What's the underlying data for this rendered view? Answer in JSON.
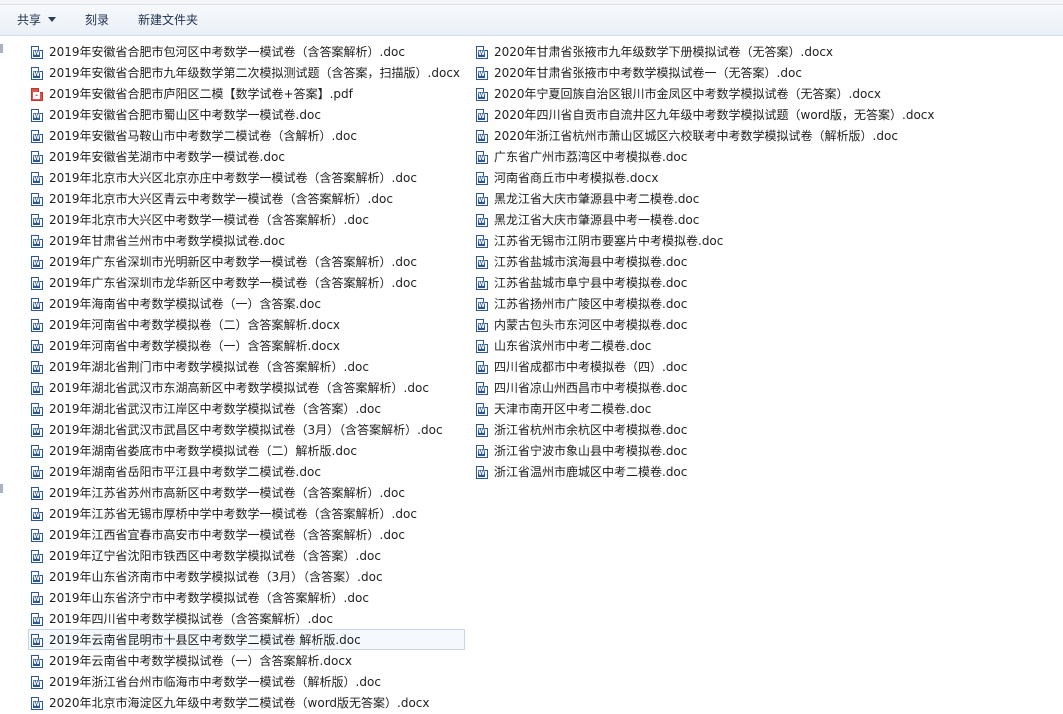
{
  "toolbar": {
    "share_label": "共享",
    "burn_label": "刻录",
    "new_folder_label": "新建文件夹"
  },
  "colors": {
    "word_icon": "#2b5797",
    "pdf_icon": "#d9534f",
    "selection_border": "#c7d5e8"
  },
  "files_col1": [
    {
      "name": "2019年安徽省合肥市包河区中考数学一模试卷（含答案解析）.doc",
      "icon": "word-icon"
    },
    {
      "name": "2019年安徽省合肥市九年级数学第二次模拟测试题（含答案，扫描版）.docx",
      "icon": "word-icon"
    },
    {
      "name": "2019年安徽省合肥市庐阳区二模【数学试卷+答案】.pdf",
      "icon": "pdf-icon"
    },
    {
      "name": "2019年安徽省合肥市蜀山区中考数学一模试卷.doc",
      "icon": "word-icon"
    },
    {
      "name": "2019年安徽省马鞍山市中考数学二模试卷（含解析）.doc",
      "icon": "word-icon"
    },
    {
      "name": "2019年安徽省芜湖市中考数学一模试卷.doc",
      "icon": "word-icon"
    },
    {
      "name": "2019年北京市大兴区北京亦庄中考数学一模试卷（含答案解析）.doc",
      "icon": "word-icon"
    },
    {
      "name": "2019年北京市大兴区青云中考数学一模试卷（含答案解析）.doc",
      "icon": "word-icon"
    },
    {
      "name": "2019年北京市大兴区中考数学一模试卷（含答案解析）.doc",
      "icon": "word-icon"
    },
    {
      "name": "2019年甘肃省兰州市中考数学模拟试卷.doc",
      "icon": "word-icon"
    },
    {
      "name": "2019年广东省深圳市光明新区中考数学一模试卷（含答案解析）.doc",
      "icon": "word-icon"
    },
    {
      "name": "2019年广东省深圳市龙华新区中考数学一模试卷（含答案解析）.doc",
      "icon": "word-icon"
    },
    {
      "name": "2019年海南省中考数学模拟试卷（一）含答案.doc",
      "icon": "word-icon"
    },
    {
      "name": "2019年河南省中考数学模拟卷（二）含答案解析.docx",
      "icon": "word-icon"
    },
    {
      "name": "2019年河南省中考数学模拟卷（一）含答案解析.docx",
      "icon": "word-icon"
    },
    {
      "name": "2019年湖北省荆门市中考数学模拟试卷（含答案解析）.doc",
      "icon": "word-icon"
    },
    {
      "name": "2019年湖北省武汉市东湖高新区中考数学模拟试卷（含答案解析）.doc",
      "icon": "word-icon"
    },
    {
      "name": "2019年湖北省武汉市江岸区中考数学模拟试卷（含答案）.doc",
      "icon": "word-icon"
    },
    {
      "name": "2019年湖北省武汉市武昌区中考数学模拟试卷（3月）（含答案解析）.doc",
      "icon": "word-icon"
    },
    {
      "name": "2019年湖南省娄底市中考数学模拟试卷（二）解析版.doc",
      "icon": "word-icon"
    },
    {
      "name": "2019年湖南省岳阳市平江县中考数学二模试卷.doc",
      "icon": "word-icon"
    },
    {
      "name": "2019年江苏省苏州市高新区中考数学一模试卷（含答案解析）.doc",
      "icon": "word-icon"
    },
    {
      "name": "2019年江苏省无锡市厚桥中学中考数学一模试卷（含答案解析）.doc",
      "icon": "word-icon"
    },
    {
      "name": "2019年江西省宜春市高安市中考数学一模试卷（含答案解析）.doc",
      "icon": "word-icon"
    },
    {
      "name": "2019年辽宁省沈阳市铁西区中考数学模拟试卷（含答案）.doc",
      "icon": "word-icon"
    },
    {
      "name": "2019年山东省济南市中考数学模拟试卷（3月）（含答案）.doc",
      "icon": "word-icon"
    },
    {
      "name": "2019年山东省济宁市中考数学模拟试卷（含答案解析）.doc",
      "icon": "word-icon"
    },
    {
      "name": "2019年四川省中考数学模拟试卷（含答案解析）.doc",
      "icon": "word-icon"
    },
    {
      "name": "2019年云南省昆明市十县区中考数学二模试卷  解析版.doc",
      "icon": "word-icon",
      "selected": true
    },
    {
      "name": "2019年云南省中考数学模拟试卷（一）含答案解析.docx",
      "icon": "word-icon"
    },
    {
      "name": "2019年浙江省台州市临海市中考数学一模试卷（解析版）.doc",
      "icon": "word-icon"
    },
    {
      "name": "2020年北京市海淀区九年级中考数学二模试卷（word版无答案）.docx",
      "icon": "word-icon"
    }
  ],
  "files_col2": [
    {
      "name": "2020年甘肃省张掖市九年级数学下册模拟试卷（无答案）.docx",
      "icon": "word-icon"
    },
    {
      "name": "2020年甘肃省张掖市中考数学模拟试卷一（无答案）.doc",
      "icon": "word-icon"
    },
    {
      "name": "2020年宁夏回族自治区银川市金凤区中考数学模拟试卷（无答案）.docx",
      "icon": "word-icon"
    },
    {
      "name": "2020年四川省自贡市自流井区九年级中考数学模拟试题（word版，无答案）.docx",
      "icon": "word-icon"
    },
    {
      "name": "2020年浙江省杭州市萧山区城区六校联考中考数学模拟试卷（解析版）.doc",
      "icon": "word-icon"
    },
    {
      "name": "广东省广州市荔湾区中考模拟卷.doc",
      "icon": "word-icon"
    },
    {
      "name": "河南省商丘市中考模拟卷.docx",
      "icon": "word-icon"
    },
    {
      "name": "黑龙江省大庆市肇源县中考二模卷.doc",
      "icon": "word-icon"
    },
    {
      "name": "黑龙江省大庆市肇源县中考一模卷.doc",
      "icon": "word-icon"
    },
    {
      "name": "江苏省无锡市江阴市要塞片中考模拟卷.doc",
      "icon": "word-icon"
    },
    {
      "name": "江苏省盐城市滨海县中考模拟卷.doc",
      "icon": "word-icon"
    },
    {
      "name": "江苏省盐城市阜宁县中考模拟卷.doc",
      "icon": "word-icon"
    },
    {
      "name": "江苏省扬州市广陵区中考模拟卷.doc",
      "icon": "word-icon"
    },
    {
      "name": "内蒙古包头市东河区中考模拟卷.doc",
      "icon": "word-icon"
    },
    {
      "name": "山东省滨州市中考二模卷.doc",
      "icon": "word-icon"
    },
    {
      "name": "四川省成都市中考模拟卷（四）.doc",
      "icon": "word-icon"
    },
    {
      "name": "四川省凉山州西昌市中考模拟卷.doc",
      "icon": "word-icon"
    },
    {
      "name": "天津市南开区中考二模卷.doc",
      "icon": "word-icon"
    },
    {
      "name": "浙江省杭州市余杭区中考模拟卷.doc",
      "icon": "word-icon"
    },
    {
      "name": "浙江省宁波市象山县中考模拟卷.doc",
      "icon": "word-icon"
    },
    {
      "name": "浙江省温州市鹿城区中考二模卷.doc",
      "icon": "word-icon"
    }
  ]
}
